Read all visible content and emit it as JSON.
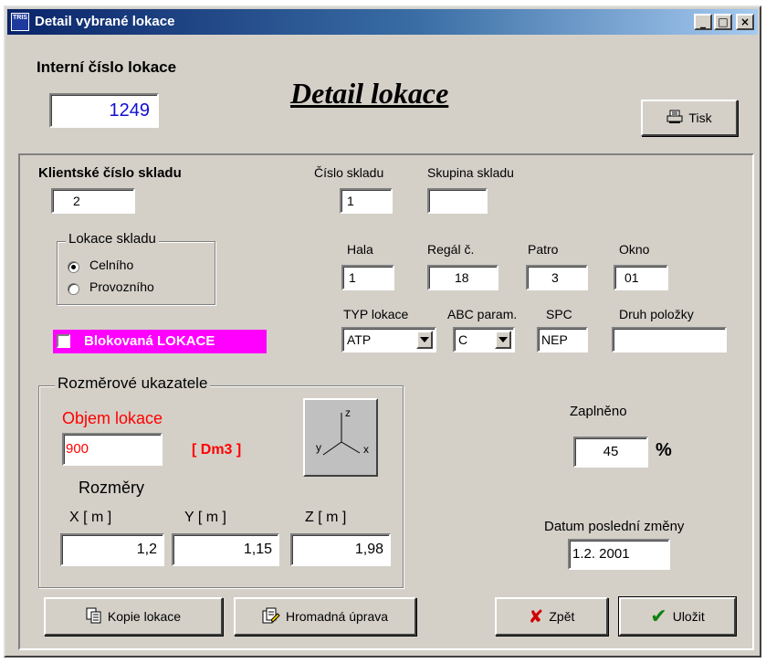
{
  "window": {
    "title": "Detail vybrané lokace",
    "app_icon_text": "TRIS",
    "minimize_label": "_",
    "maximize_label": "□",
    "close_label": "×"
  },
  "header": {
    "internal_label": "Interní číslo lokace",
    "internal_value": "1249",
    "heading": "Detail lokace",
    "print_label": "Tisk"
  },
  "client": {
    "label": "Klientské číslo skladu",
    "value": "2"
  },
  "warehouse": {
    "number_label": "Číslo skladu",
    "number_value": "1",
    "group_label": "Skupina skladu",
    "group_value": ""
  },
  "location_type_group": {
    "title": "Lokace skladu",
    "options": [
      "Celního",
      "Provozního"
    ],
    "selected": "Celního"
  },
  "position": {
    "hala_label": "Hala",
    "hala_value": "1",
    "regal_label": "Regál č.",
    "regal_value": "18",
    "patro_label": "Patro",
    "patro_value": "3",
    "okno_label": "Okno",
    "okno_value": "01"
  },
  "params": {
    "typ_label": "TYP lokace",
    "typ_value": "ATP",
    "abc_label": "ABC param.",
    "abc_value": "C",
    "spc_label": "SPC",
    "spc_value": "NEP",
    "druh_label": "Druh položky",
    "druh_value": ""
  },
  "blocked": {
    "label": "Blokovaná LOKACE",
    "checked": false,
    "color": "#ff00ff"
  },
  "dimensions": {
    "title": "Rozměrové ukazatele",
    "volume_label": "Objem lokace",
    "volume_value": "900",
    "volume_unit": "[ Dm3 ]",
    "sizes_label": "Rozměry",
    "x_label": "X [ m ]",
    "x_value": "1,2",
    "y_label": "Y [ m ]",
    "y_value": "1,15",
    "z_label": "Z [ m ]",
    "z_value": "1,98",
    "axis_z": "z",
    "axis_y": "y",
    "axis_x": "x",
    "accent_color": "#ff0000"
  },
  "fill": {
    "label": "Zaplněno",
    "value": "45",
    "unit": "%"
  },
  "last_change": {
    "label": "Datum poslední změny",
    "value": "1.2. 2001"
  },
  "footer": {
    "copy_label": "Kopie lokace",
    "bulk_label": "Hromadná úprava",
    "back_label": "Zpět",
    "save_label": "Uložit"
  }
}
